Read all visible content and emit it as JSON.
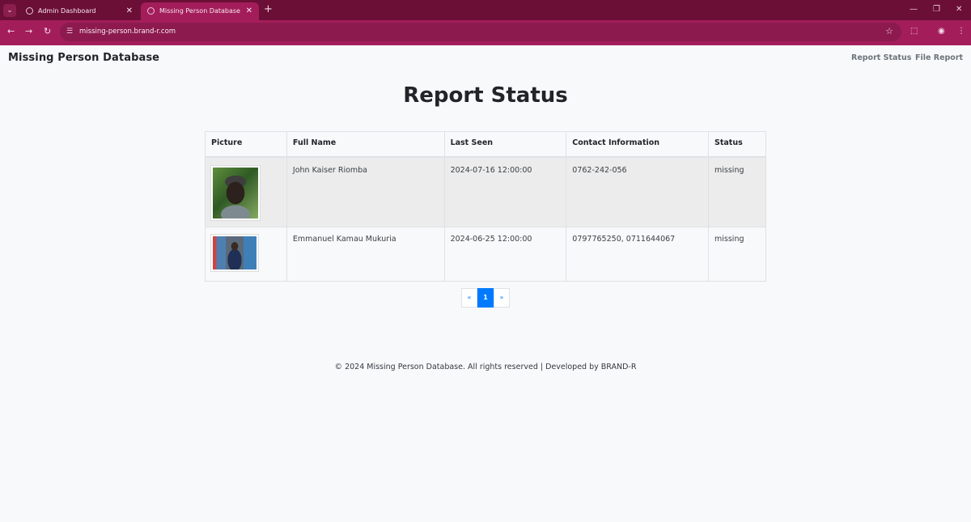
{
  "browser": {
    "tabs": [
      {
        "title": "Admin Dashboard",
        "active": false
      },
      {
        "title": "Missing Person Database",
        "active": true
      }
    ],
    "url": "missing-person.brand-r.com",
    "theme_color": "#a31d5b"
  },
  "site": {
    "brand": "Missing Person Database",
    "nav": {
      "report_status": "Report Status",
      "file_report": "File Report"
    }
  },
  "main": {
    "title": "Report Status",
    "table": {
      "headers": {
        "picture": "Picture",
        "full_name": "Full Name",
        "last_seen": "Last Seen",
        "contact": "Contact Information",
        "status": "Status"
      },
      "rows": [
        {
          "full_name": "John Kaiser Riomba",
          "last_seen": "2024-07-16 12:00:00",
          "contact": "0762-242-056",
          "status": "missing"
        },
        {
          "full_name": "Emmanuel Kamau Mukuria",
          "last_seen": "2024-06-25 12:00:00",
          "contact": "0797765250, 0711644067",
          "status": "missing"
        }
      ]
    },
    "pagination": {
      "prev": "«",
      "current": "1",
      "next": "»"
    }
  },
  "footer": {
    "text": "© 2024 Missing Person Database. All rights reserved | Developed by BRAND-R"
  },
  "icons": [
    "tab-search-icon",
    "globe-icon",
    "close-icon",
    "new-tab-icon",
    "minimize-icon",
    "maximize-icon",
    "window-close-icon",
    "back-icon",
    "forward-icon",
    "reload-icon",
    "site-settings-icon",
    "bookmark-star-icon",
    "extensions-icon",
    "profile-icon",
    "menu-icon"
  ]
}
